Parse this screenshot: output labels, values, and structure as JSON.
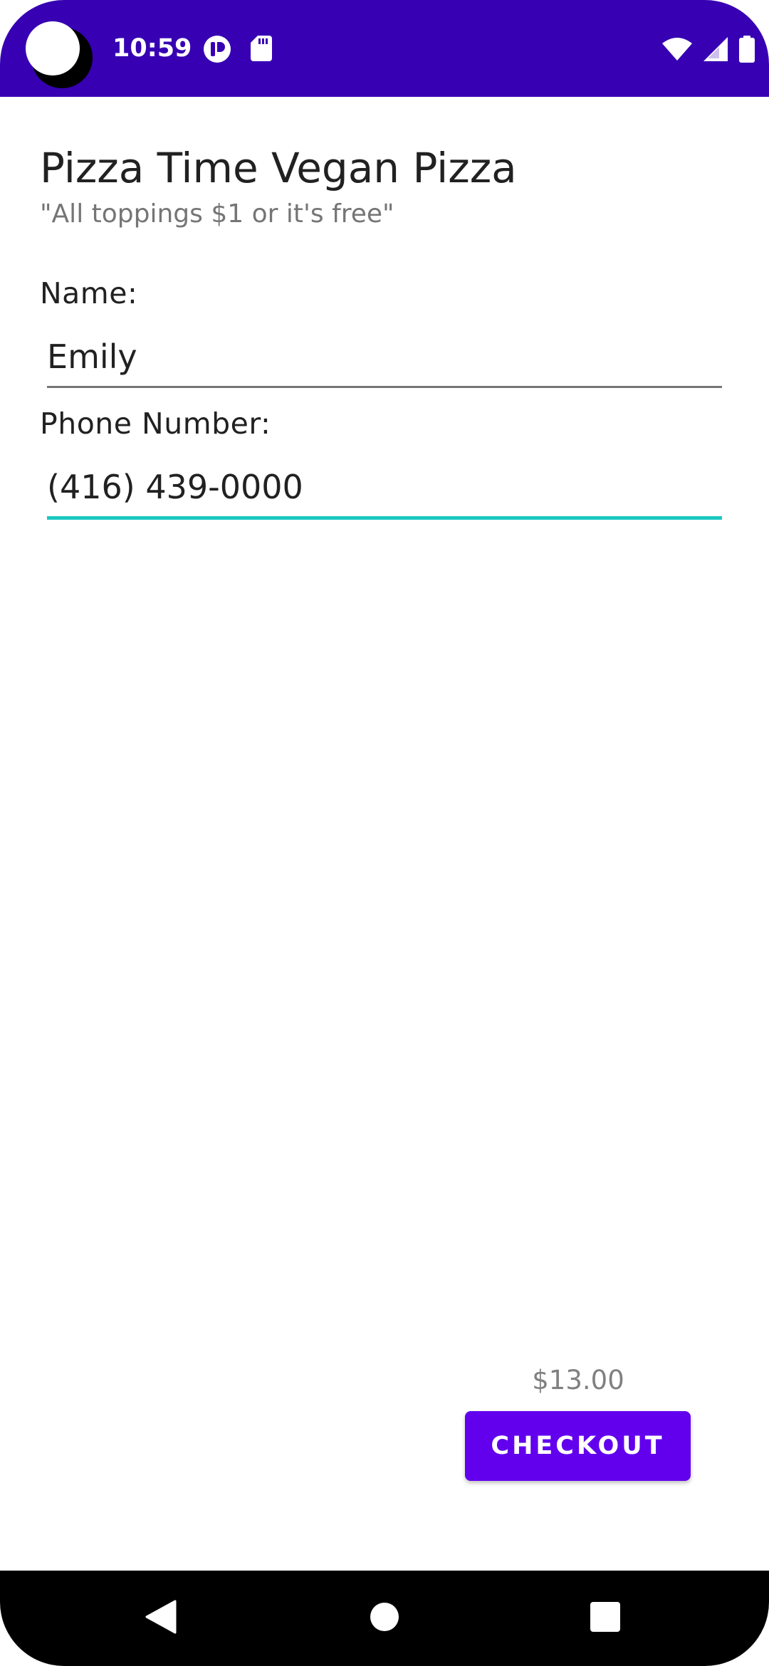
{
  "status_bar": {
    "time": "10:59",
    "background": "#3700b3",
    "icons_left": [
      "camera-cutout",
      "notification-app-icon",
      "sd-card-icon"
    ],
    "icons_right": [
      "wifi-icon",
      "cell-signal-icon",
      "battery-icon"
    ]
  },
  "header": {
    "title": "Pizza Time Vegan Pizza",
    "subtitle": "\"All toppings $1 or it's free\""
  },
  "form": {
    "name_label": "Name:",
    "name_value": "Emily",
    "phone_label": "Phone Number:",
    "phone_value": "(416) 439-0000",
    "focused_field": "phone",
    "focus_color": "#1cc8c1"
  },
  "footer": {
    "price": "$13.00",
    "checkout_label": "CHECKOUT",
    "button_color": "#6200ee"
  },
  "nav_bar": {
    "buttons": [
      "back-icon",
      "home-icon",
      "recents-icon"
    ]
  }
}
